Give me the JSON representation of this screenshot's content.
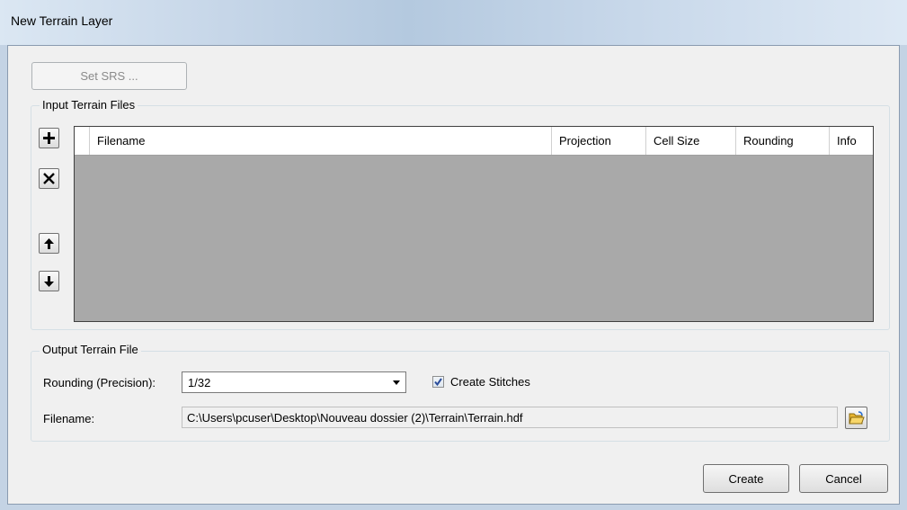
{
  "window": {
    "title": "New Terrain Layer"
  },
  "toolbar": {
    "set_srs_label": "Set SRS ..."
  },
  "input_group": {
    "title": "Input Terrain Files",
    "columns": [
      "Filename",
      "Projection",
      "Cell Size",
      "Rounding",
      "Info"
    ],
    "rows": []
  },
  "output_group": {
    "title": "Output Terrain File",
    "rounding_label": "Rounding (Precision):",
    "rounding_value": "1/32",
    "create_stitches_label": "Create Stitches",
    "create_stitches_checked": true,
    "filename_label": "Filename:",
    "filename_value": "C:\\Users\\pcuser\\Desktop\\Nouveau dossier (2)\\Terrain\\Terrain.hdf"
  },
  "footer": {
    "create_label": "Create",
    "cancel_label": "Cancel"
  },
  "icons": [
    "add-icon",
    "remove-icon",
    "move-up-icon",
    "move-down-icon",
    "checkmark-icon",
    "folder-open-icon",
    "dropdown-arrow-icon"
  ]
}
